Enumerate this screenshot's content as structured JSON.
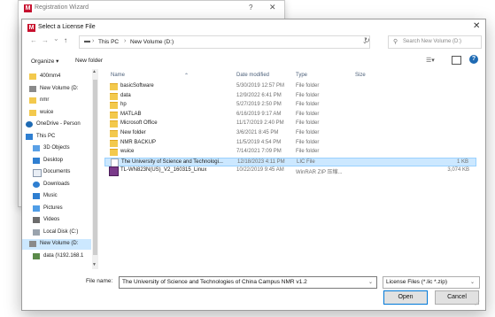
{
  "wizard": {
    "title": "Registration Wizard",
    "help": "?",
    "close": "✕",
    "logo": "M"
  },
  "dialog": {
    "title": "Select a License File",
    "close": "✕",
    "logo": "M"
  },
  "address": {
    "back": "←",
    "forward": "→",
    "dropdown": "⌄",
    "up": "↑",
    "crumbs": [
      "This PC",
      "New Volume (D:)"
    ],
    "separator": "›",
    "refresh": "↻",
    "search_placeholder": "Search New Volume (D:)"
  },
  "toolbar": {
    "organize": "Organize ▾",
    "new_folder": "New folder"
  },
  "nav": [
    {
      "label": "400mm4",
      "icon": "folder"
    },
    {
      "label": "New Volume (D:",
      "icon": "drive"
    },
    {
      "label": "nmr",
      "icon": "folder"
    },
    {
      "label": "wuice",
      "icon": "folder"
    },
    {
      "label": "OneDrive - Person",
      "icon": "cloud"
    },
    {
      "label": "This PC",
      "icon": "pc"
    },
    {
      "label": "3D Objects",
      "icon": "cube"
    },
    {
      "label": "Desktop",
      "icon": "desktop"
    },
    {
      "label": "Documents",
      "icon": "doc"
    },
    {
      "label": "Downloads",
      "icon": "download"
    },
    {
      "label": "Music",
      "icon": "music"
    },
    {
      "label": "Pictures",
      "icon": "pictures"
    },
    {
      "label": "Videos",
      "icon": "videos"
    },
    {
      "label": "Local Disk (C:)",
      "icon": "disk"
    },
    {
      "label": "New Volume (D:",
      "icon": "drive"
    },
    {
      "label": "data (\\\\192.168.1",
      "icon": "network"
    }
  ],
  "columns": {
    "name": "Name",
    "date": "Date modified",
    "type": "Type",
    "size": "Size"
  },
  "files": [
    {
      "name": "basicSoftware",
      "date": "5/30/2019 12:57 PM",
      "type": "File folder",
      "size": "",
      "icon": "folder"
    },
    {
      "name": "data",
      "date": "12/9/2022 6:41 PM",
      "type": "File folder",
      "size": "",
      "icon": "folder"
    },
    {
      "name": "hp",
      "date": "5/27/2019 2:50 PM",
      "type": "File folder",
      "size": "",
      "icon": "folder"
    },
    {
      "name": "MATLAB",
      "date": "6/16/2019 9:17 AM",
      "type": "File folder",
      "size": "",
      "icon": "folder"
    },
    {
      "name": "Microsoft Office",
      "date": "11/17/2019 2:40 PM",
      "type": "File folder",
      "size": "",
      "icon": "folder"
    },
    {
      "name": "New folder",
      "date": "3/6/2021 8:45 PM",
      "type": "File folder",
      "size": "",
      "icon": "folder"
    },
    {
      "name": "NMR BACKUP",
      "date": "11/5/2019 4:54 PM",
      "type": "File folder",
      "size": "",
      "icon": "folder"
    },
    {
      "name": "wuice",
      "date": "7/14/2021 7:09 PM",
      "type": "File folder",
      "size": "",
      "icon": "folder"
    },
    {
      "name": "The University of Science and Technologi...",
      "date": "12/18/2023 4:11 PM",
      "type": "LIC File",
      "size": "1 KB",
      "icon": "file",
      "selected": true
    },
    {
      "name": "TL-WN823N(US)_V2_160315_Linux",
      "date": "10/22/2019 9:45 AM",
      "type": "WinRAR ZIP 压缩...",
      "size": "3,074 KB",
      "icon": "zip"
    }
  ],
  "filename": {
    "label": "File name:",
    "value": "The University of Science and Technologies of China Campus NMR v1.2",
    "dropdown": "⌄"
  },
  "filetype": {
    "value": "License Files (*.lic *.zip)",
    "dropdown": "⌄"
  },
  "buttons": {
    "open": "Open",
    "cancel": "Cancel"
  },
  "colors": {
    "accent": "#0078d7",
    "selection": "#cce8ff",
    "folder": "#f3c94d",
    "brand": "#c8102e"
  }
}
